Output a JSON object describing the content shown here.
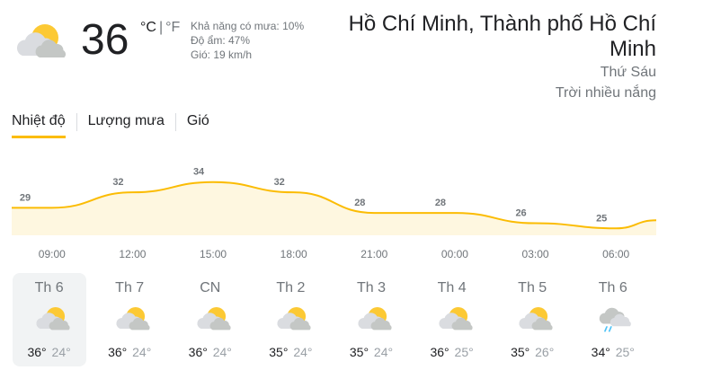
{
  "current": {
    "temperature": "36",
    "unit_c": "°C",
    "unit_sep": "|",
    "unit_f": "°F",
    "rain_chance": "Khả năng có mưa: 10%",
    "humidity": "Độ ẩm: 47%",
    "wind": "Gió: 19 km/h",
    "icon": "partly-sunny-icon"
  },
  "location": {
    "name": "Hồ Chí Minh, Thành phố Hồ Chí Minh",
    "day": "Thứ Sáu",
    "condition": "Trời nhiều nắng"
  },
  "tabs": [
    {
      "label": "Nhiệt độ",
      "active": true
    },
    {
      "label": "Lượng mưa",
      "active": false
    },
    {
      "label": "Gió",
      "active": false
    }
  ],
  "chart_data": {
    "type": "area",
    "x": [
      "09:00",
      "12:00",
      "15:00",
      "18:00",
      "21:00",
      "00:00",
      "03:00",
      "06:00"
    ],
    "values": [
      29,
      32,
      34,
      32,
      28,
      28,
      26,
      25
    ],
    "labels": [
      "29",
      "32",
      "34",
      "32",
      "28",
      "28",
      "26",
      "25"
    ],
    "line_color": "#fbbc04",
    "fill_color": "#fef7e0"
  },
  "forecast": [
    {
      "day": "Th 6",
      "high": "36°",
      "low": "24°",
      "icon": "partly-sunny-icon",
      "selected": true
    },
    {
      "day": "Th 7",
      "high": "36°",
      "low": "24°",
      "icon": "partly-sunny-icon",
      "selected": false
    },
    {
      "day": "CN",
      "high": "36°",
      "low": "24°",
      "icon": "partly-sunny-icon",
      "selected": false
    },
    {
      "day": "Th 2",
      "high": "35°",
      "low": "24°",
      "icon": "partly-sunny-icon",
      "selected": false
    },
    {
      "day": "Th 3",
      "high": "35°",
      "low": "24°",
      "icon": "partly-sunny-icon",
      "selected": false
    },
    {
      "day": "Th 4",
      "high": "36°",
      "low": "25°",
      "icon": "partly-sunny-icon",
      "selected": false
    },
    {
      "day": "Th 5",
      "high": "35°",
      "low": "26°",
      "icon": "partly-sunny-icon",
      "selected": false
    },
    {
      "day": "Th 6",
      "high": "34°",
      "low": "25°",
      "icon": "rain-shower-icon",
      "selected": false
    }
  ]
}
